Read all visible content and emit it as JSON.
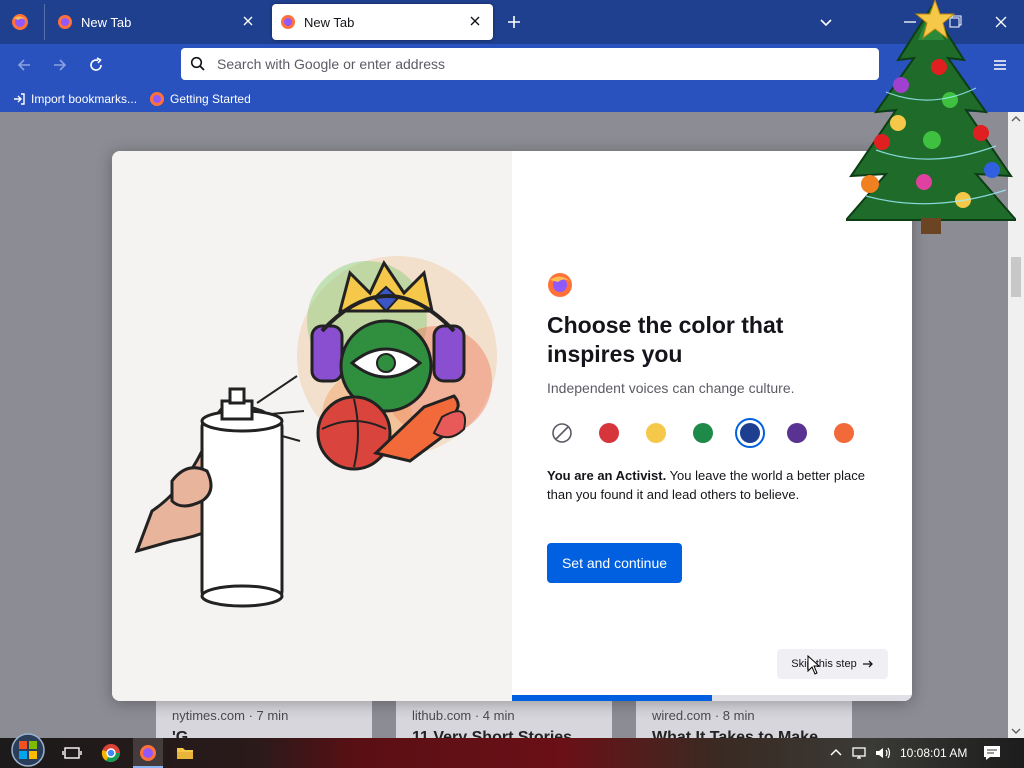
{
  "browser": {
    "tabs": [
      {
        "label": "New Tab",
        "active": false
      },
      {
        "label": "New Tab",
        "active": true
      }
    ],
    "urlbar": {
      "placeholder": "Search with Google or enter address",
      "value": ""
    },
    "bookmarks": [
      {
        "label": "Import bookmarks...",
        "icon": "import-icon"
      },
      {
        "label": "Getting Started",
        "icon": "firefox-icon"
      }
    ]
  },
  "cards": [
    {
      "source": "nytimes.com · 7 min",
      "title": "'G"
    },
    {
      "source": "lithub.com · 4 min",
      "title": "11 Very Short Stories"
    },
    {
      "source": "wired.com · 8 min",
      "title": "What It Takes to Make"
    }
  ],
  "dialog": {
    "heading": "Choose the color that inspires you",
    "subheading": "Independent voices can change culture.",
    "swatches": [
      {
        "name": "none",
        "color": "#ffffff"
      },
      {
        "name": "red",
        "color": "#d6353c"
      },
      {
        "name": "yellow",
        "color": "#f5c84a"
      },
      {
        "name": "green",
        "color": "#1d8a4a"
      },
      {
        "name": "blue",
        "color": "#1e3f8f"
      },
      {
        "name": "purple",
        "color": "#5a3291"
      },
      {
        "name": "orange",
        "color": "#f26a3a"
      }
    ],
    "selected_swatch": "blue",
    "description_bold": "You are an Activist.",
    "description_rest": " You leave the world a better place than you found it and lead others to believe.",
    "primary_label": "Set and continue",
    "skip_label": "Skip this step",
    "progress": 0.5
  },
  "taskbar": {
    "clock": "10:08:01 AM"
  }
}
